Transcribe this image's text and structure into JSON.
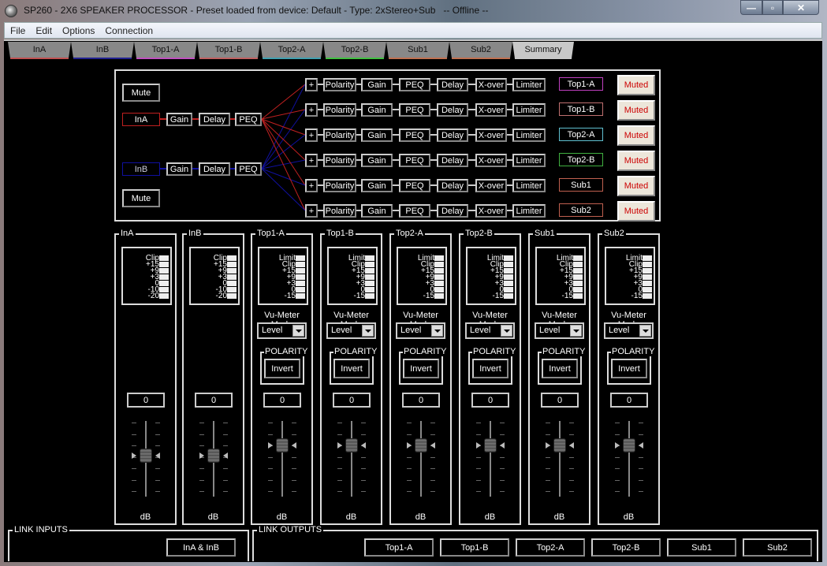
{
  "window": {
    "title": "SP260 - 2X6 SPEAKER PROCESSOR - Preset loaded from device: Default - Type: 2xStereo+Sub   -- Offline --",
    "controls": {
      "minimize": "—",
      "maximize": "▫",
      "close": "✕"
    }
  },
  "menu": [
    "File",
    "Edit",
    "Options",
    "Connection"
  ],
  "tabs": [
    {
      "label": "InA",
      "color": "#c05050"
    },
    {
      "label": "InB",
      "color": "#202090"
    },
    {
      "label": "Top1-A",
      "color": "#c050c0"
    },
    {
      "label": "Top1-B",
      "color": "#c06060"
    },
    {
      "label": "Top2-A",
      "color": "#40a0b0"
    },
    {
      "label": "Top2-B",
      "color": "#40c040"
    },
    {
      "label": "Sub1",
      "color": "#c07050"
    },
    {
      "label": "Sub2",
      "color": "#c07050"
    },
    {
      "label": "Summary",
      "color": "#c8c8c8",
      "active": true
    }
  ],
  "routing": {
    "inputs": [
      {
        "mute": "Mute",
        "label": "InA",
        "chain": [
          "Gain",
          "Delay",
          "PEQ"
        ],
        "color": "#c02020"
      },
      {
        "mute": "Mute",
        "label": "InB",
        "chain": [
          "Gain",
          "Delay",
          "PEQ"
        ],
        "color": "#1010a0"
      }
    ],
    "outputs": [
      {
        "label": "Top1-A",
        "color": "#c040c0",
        "state": "Muted"
      },
      {
        "label": "Top1-B",
        "color": "#c07070",
        "state": "Muted"
      },
      {
        "label": "Top2-A",
        "color": "#60c0d0",
        "state": "Muted"
      },
      {
        "label": "Top2-B",
        "color": "#40b040",
        "state": "Muted"
      },
      {
        "label": "Sub1",
        "color": "#c06050",
        "state": "Muted"
      },
      {
        "label": "Sub2",
        "color": "#c06050",
        "state": "Muted"
      }
    ],
    "output_chain": [
      "+",
      "Polarity",
      "Gain",
      "PEQ",
      "Delay",
      "X-over",
      "Limiter"
    ]
  },
  "strips": [
    {
      "name": "InA",
      "type": "input",
      "meter": [
        "Clip",
        "+15",
        "+9",
        "+3",
        "0",
        "-10",
        "-20"
      ],
      "value": "0",
      "fader_db": 0,
      "unit": "dB"
    },
    {
      "name": "InB",
      "type": "input",
      "meter": [
        "Clip",
        "+15",
        "+9",
        "+3",
        "0",
        "-10",
        "-20"
      ],
      "value": "0",
      "fader_db": 0,
      "unit": "dB"
    },
    {
      "name": "Top1-A",
      "type": "output",
      "meter": [
        "Limit",
        "Clip",
        "+15",
        "+9",
        "+3",
        "0",
        "-15"
      ],
      "vu_label": "Vu-Meter Mode",
      "vu_mode": "Level",
      "polarity_label": "POLARITY",
      "polarity_button": "Invert",
      "value": "0",
      "fader_db": 0,
      "unit": "dB"
    },
    {
      "name": "Top1-B",
      "type": "output",
      "meter": [
        "Limit",
        "Clip",
        "+15",
        "+9",
        "+3",
        "0",
        "-15"
      ],
      "vu_label": "Vu-Meter Mode",
      "vu_mode": "Level",
      "polarity_label": "POLARITY",
      "polarity_button": "Invert",
      "value": "0",
      "fader_db": 0,
      "unit": "dB"
    },
    {
      "name": "Top2-A",
      "type": "output",
      "meter": [
        "Limit",
        "Clip",
        "+15",
        "+9",
        "+3",
        "0",
        "-15"
      ],
      "vu_label": "Vu-Meter Mode",
      "vu_mode": "Level",
      "polarity_label": "POLARITY",
      "polarity_button": "Invert",
      "value": "0",
      "fader_db": 0,
      "unit": "dB"
    },
    {
      "name": "Top2-B",
      "type": "output",
      "meter": [
        "Limit",
        "Clip",
        "+15",
        "+9",
        "+3",
        "0",
        "-15"
      ],
      "vu_label": "Vu-Meter Mode",
      "vu_mode": "Level",
      "polarity_label": "POLARITY",
      "polarity_button": "Invert",
      "value": "0",
      "fader_db": 0,
      "unit": "dB"
    },
    {
      "name": "Sub1",
      "type": "output",
      "meter": [
        "Limit",
        "Clip",
        "+15",
        "+9",
        "+3",
        "0",
        "-15"
      ],
      "vu_label": "Vu-Meter Mode",
      "vu_mode": "Level",
      "polarity_label": "POLARITY",
      "polarity_button": "Invert",
      "value": "0",
      "fader_db": 0,
      "unit": "dB"
    },
    {
      "name": "Sub2",
      "type": "output",
      "meter": [
        "Limit",
        "Clip",
        "+15",
        "+9",
        "+3",
        "0",
        "-15"
      ],
      "vu_label": "Vu-Meter Mode",
      "vu_mode": "Level",
      "polarity_label": "POLARITY",
      "polarity_button": "Invert",
      "value": "0",
      "fader_db": 0,
      "unit": "dB"
    }
  ],
  "link_inputs": {
    "title": "LINK INPUTS",
    "buttons": [
      "InA & InB"
    ]
  },
  "link_outputs": {
    "title": "LINK OUTPUTS",
    "buttons": [
      "Top1-A",
      "Top1-B",
      "Top2-A",
      "Top2-B",
      "Sub1",
      "Sub2"
    ]
  }
}
